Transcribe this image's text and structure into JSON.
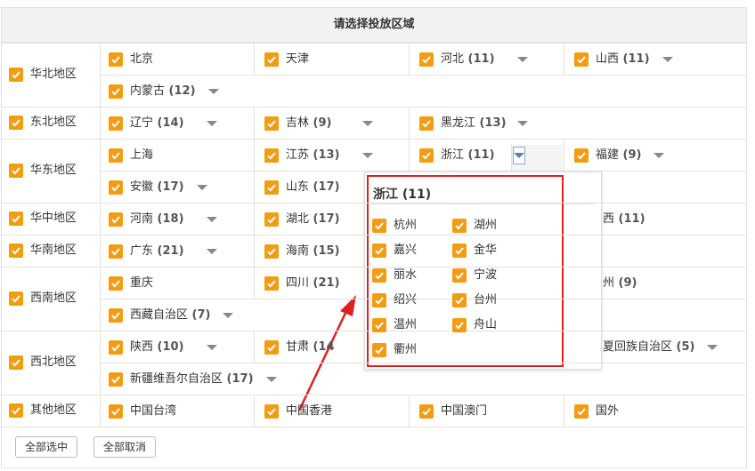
{
  "title": "请选择投放区域",
  "regions": [
    {
      "name": "华北地区",
      "provinces": [
        {
          "name": "北京",
          "count": null,
          "dropdown": false
        },
        {
          "name": "天津",
          "count": null,
          "dropdown": false
        },
        {
          "name": "河北",
          "count": "(11)",
          "dropdown": true
        },
        {
          "name": "山西",
          "count": "(11)",
          "dropdown": true
        },
        {
          "name": "内蒙古",
          "count": "(12)",
          "dropdown": true
        }
      ]
    },
    {
      "name": "东北地区",
      "provinces": [
        {
          "name": "辽宁",
          "count": "(14)",
          "dropdown": true
        },
        {
          "name": "吉林",
          "count": "(9)",
          "dropdown": true
        },
        {
          "name": "黑龙江",
          "count": "(13)",
          "dropdown": true
        }
      ]
    },
    {
      "name": "华东地区",
      "provinces": [
        {
          "name": "上海",
          "count": null,
          "dropdown": false
        },
        {
          "name": "江苏",
          "count": "(13)",
          "dropdown": true
        },
        {
          "name": "浙江",
          "count": "(11)",
          "dropdown": true
        },
        {
          "name": "福建",
          "count": "(9)",
          "dropdown": true
        },
        {
          "name": "安徽",
          "count": "(17)",
          "dropdown": true
        },
        {
          "name": "山东",
          "count": "(17)",
          "dropdown": false
        }
      ]
    },
    {
      "name": "华中地区",
      "provinces": [
        {
          "name": "河南",
          "count": "(18)",
          "dropdown": true
        },
        {
          "name": "湖北",
          "count": "(17)",
          "dropdown": false
        },
        {
          "name": "西",
          "count": "(11)",
          "dropdown": false
        }
      ]
    },
    {
      "name": "华南地区",
      "provinces": [
        {
          "name": "广东",
          "count": "(21)",
          "dropdown": true
        },
        {
          "name": "海南",
          "count": "(15)",
          "dropdown": false
        }
      ]
    },
    {
      "name": "西南地区",
      "provinces": [
        {
          "name": "重庆",
          "count": null,
          "dropdown": false
        },
        {
          "name": "四川",
          "count": "(21)",
          "dropdown": false
        },
        {
          "name": "州",
          "count": "(9)",
          "dropdown": false
        },
        {
          "name": "西藏自治区",
          "count": "(7)",
          "dropdown": true
        }
      ]
    },
    {
      "name": "西北地区",
      "provinces": [
        {
          "name": "陕西",
          "count": "(10)",
          "dropdown": true
        },
        {
          "name": "甘肃",
          "count": "(14",
          "dropdown": false
        },
        {
          "name": "夏回族自治区",
          "count": "(5)",
          "dropdown": true
        },
        {
          "name": "新疆维吾尔自治区",
          "count": "(17)",
          "dropdown": true
        }
      ]
    },
    {
      "name": "其他地区",
      "provinces": [
        {
          "name": "中国台湾",
          "count": null,
          "dropdown": false
        },
        {
          "name": "中国香港",
          "count": null,
          "dropdown": false
        },
        {
          "name": "中国澳门",
          "count": null,
          "dropdown": false
        },
        {
          "name": "国外",
          "count": null,
          "dropdown": false
        }
      ]
    }
  ],
  "popup": {
    "title": "浙江 (11)",
    "cities": [
      "杭州",
      "湖州",
      "嘉兴",
      "金华",
      "丽水",
      "宁波",
      "绍兴",
      "台州",
      "温州",
      "舟山",
      "衢州"
    ]
  },
  "buttons": {
    "select_all": "全部选中",
    "deselect_all": "全部取消"
  },
  "colors": {
    "checkbox": "#f39c12",
    "highlight_box": "#e02020",
    "header_bg": "#f2f2f2"
  }
}
